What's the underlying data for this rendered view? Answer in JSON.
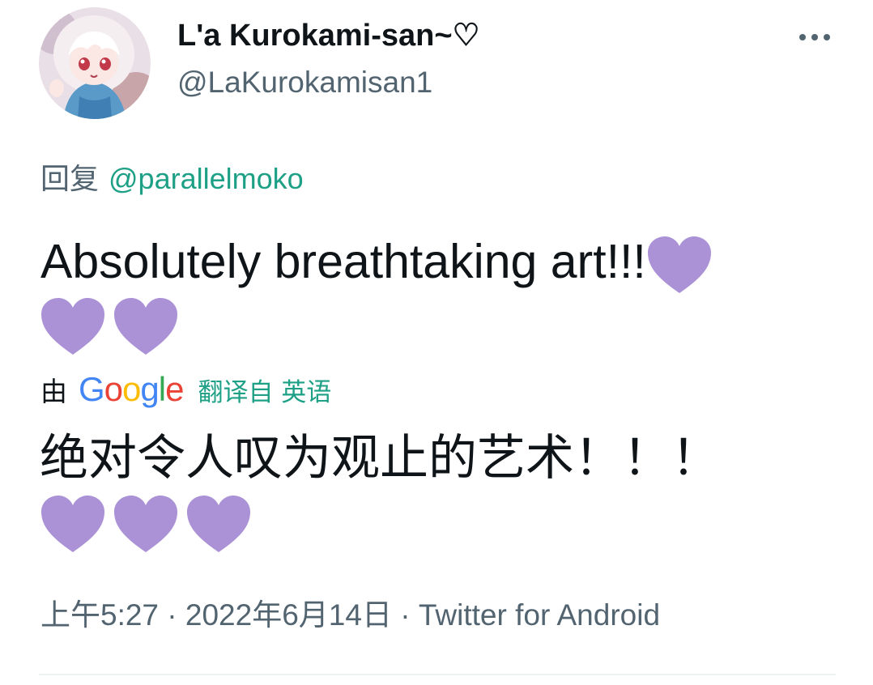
{
  "author": {
    "display_name": "L'a Kurokami-san~♡",
    "handle": "@LaKurokamisan1",
    "avatar_icon": "anime-avatar"
  },
  "menu": {
    "icon": "more-icon"
  },
  "reply": {
    "prefix": "回复",
    "mention": "@parallelmoko"
  },
  "tweet": {
    "text": "Absolutely breathtaking art!!!",
    "heart_color": "#ab91d6",
    "emoji_name": "purple-heart"
  },
  "translation": {
    "by_label": "由",
    "provider": "Google",
    "link": "翻译自 英语",
    "text": "绝对令人叹为观止的艺术！！！"
  },
  "meta": {
    "time": "上午5:27",
    "separator": "·",
    "date": "2022年6月14日",
    "source": "Twitter for Android"
  },
  "colors": {
    "text": "#0f1419",
    "secondary": "#536471",
    "link": "#1da086",
    "divider": "#eff3f4"
  }
}
